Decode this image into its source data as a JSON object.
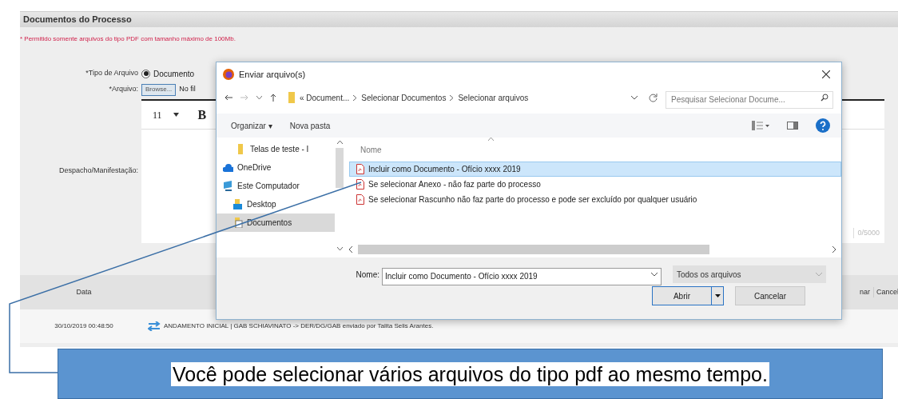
{
  "panel": {
    "title": "Documentos do Processo",
    "note": "* Permitido somente arquivos do tipo PDF com tamanho máximo de 100Mb."
  },
  "form": {
    "file_type_label": "*Tipo de Arquivo",
    "file_type_options": [
      {
        "label": "Documento",
        "selected": true
      }
    ],
    "file_label": "*Arquivo:",
    "browse_button": "Browse...",
    "file_status": "No fil",
    "editor_label": "Despacho/Manifestação:",
    "font_size": "11",
    "bold_button": "B",
    "counter": "0/5000"
  },
  "history": {
    "columns": [
      "Data",
      "nar",
      "Cancel"
    ],
    "rows": [
      {
        "date": "30/10/2019 00:48:50",
        "text": "ANDAMENTO INICIAL | GAB SCHIAVINATO -> DER/DG/GAB enviado por Talita Selis Arantes."
      }
    ]
  },
  "dialog": {
    "title": "Enviar arquivo(s)",
    "breadcrumbs": [
      "« Document...",
      "Selecionar Documentos",
      "Selecionar arquivos"
    ],
    "search_placeholder": "Pesquisar Selecionar Docume...",
    "organize": "Organizar ▾",
    "new_folder": "Nova pasta",
    "nav_items": [
      {
        "kind": "folder",
        "label": "Telas de teste - I",
        "selected": false
      },
      {
        "kind": "cloud",
        "label": "OneDrive",
        "selected": false
      },
      {
        "kind": "computer",
        "label": "Este Computador",
        "selected": false
      },
      {
        "kind": "desktop",
        "label": "Desktop",
        "selected": false
      },
      {
        "kind": "documents",
        "label": "Documentos",
        "selected": true
      }
    ],
    "column": "Nome",
    "files": [
      {
        "name": "Incluir como Documento - Ofício xxxx 2019",
        "selected": true
      },
      {
        "name": "Se selecionar Anexo - não faz parte do processo",
        "selected": false
      },
      {
        "name": "Se selecionar Rascunho não faz parte do processo e pode ser excluído por qualquer usuário",
        "selected": false
      }
    ],
    "name_label": "Nome:",
    "name_value": "Incluir como Documento - Ofício xxxx 2019",
    "filter": "Todos os arquivos",
    "open_button": "Abrir",
    "cancel_button": "Cancelar"
  },
  "callout": "Você pode selecionar vários arquivos do tipo pdf ao mesmo tempo."
}
